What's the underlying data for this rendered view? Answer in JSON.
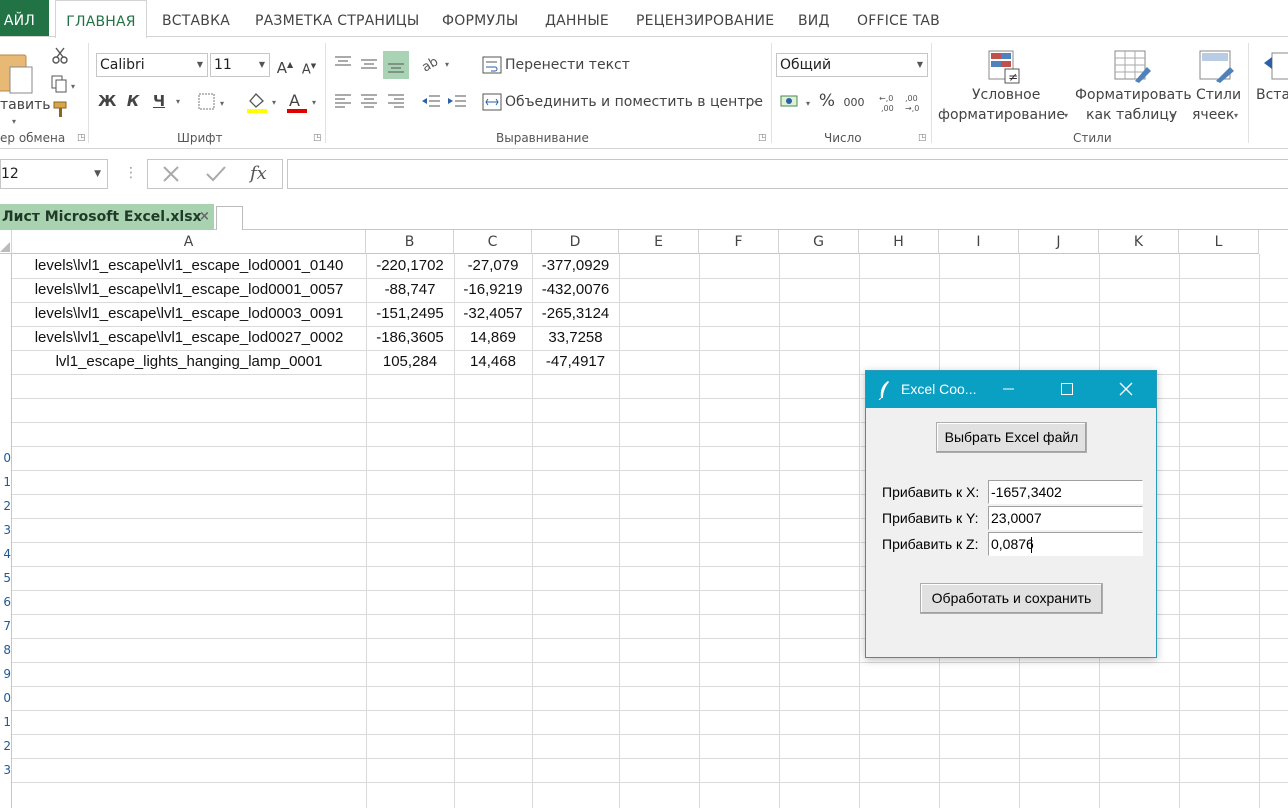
{
  "ribbon": {
    "tabs": [
      "АЙЛ",
      "ГЛАВНАЯ",
      "ВСТАВКА",
      "РАЗМЕТКА СТРАНИЦЫ",
      "ФОРМУЛЫ",
      "ДАННЫЕ",
      "РЕЦЕНЗИРОВАНИЕ",
      "ВИД",
      "OFFICE TAB"
    ],
    "active_tab": "ГЛАВНАЯ",
    "clipboard": {
      "paste_label": "тавить",
      "group_label": "ер обмена"
    },
    "font": {
      "name": "Calibri",
      "size": "11",
      "bold": "Ж",
      "italic": "К",
      "underline": "Ч",
      "group_label": "Шрифт"
    },
    "alignment": {
      "wrap_text": "Перенести текст",
      "merge_center": "Объединить и поместить в центре",
      "group_label": "Выравнивание"
    },
    "number": {
      "format": "Общий",
      "percent": "%",
      "thousands": "000",
      "group_label": "Число"
    },
    "styles": {
      "conditional_line1": "Условное",
      "conditional_line2": "форматирование",
      "format_table_line1": "Форматировать",
      "format_table_line2": "как таблицу",
      "cell_styles_line1": "Стили",
      "cell_styles_line2": "ячеек",
      "group_label": "Стили"
    },
    "cells": {
      "insert_label": "Вста"
    }
  },
  "formula_bar": {
    "name_box": "12",
    "fx": "fx",
    "value": ""
  },
  "doc_tab": {
    "title": "Лист Microsoft Excel.xlsx",
    "close": "×"
  },
  "grid": {
    "columns": [
      "A",
      "B",
      "C",
      "D",
      "E",
      "F",
      "G",
      "H",
      "I",
      "J",
      "K",
      "L"
    ],
    "row_numbers": [
      "",
      "",
      "",
      "",
      "",
      "",
      "",
      "",
      "0",
      "1",
      "2",
      "3",
      "4",
      "5",
      "6",
      "7",
      "8",
      "9",
      "0",
      "1",
      "2",
      "3"
    ],
    "rows": [
      [
        "levels\\lvl1_escape\\lvl1_escape_lod0001_0140",
        "-220,1702",
        "-27,079",
        "-377,0929"
      ],
      [
        "levels\\lvl1_escape\\lvl1_escape_lod0001_0057",
        "-88,747",
        "-16,9219",
        "-432,0076"
      ],
      [
        "levels\\lvl1_escape\\lvl1_escape_lod0003_0091",
        "-151,2495",
        "-32,4057",
        "-265,3124"
      ],
      [
        "levels\\lvl1_escape\\lvl1_escape_lod0027_0002",
        "-186,3605",
        "14,869",
        "33,7258"
      ],
      [
        "lvl1_escape_lights_hanging_lamp_0001",
        "105,284",
        "14,468",
        "-47,4917"
      ]
    ]
  },
  "dialog": {
    "title": "Excel Coo...",
    "choose_button": "Выбрать Excel файл",
    "x_label": "Прибавить к X:",
    "x_value": "-1657,3402",
    "y_label": "Прибавить к Y:",
    "y_value": "23,0007",
    "z_label": "Прибавить к Z:",
    "z_value": "0,0876",
    "process_button": "Обработать и сохранить"
  }
}
